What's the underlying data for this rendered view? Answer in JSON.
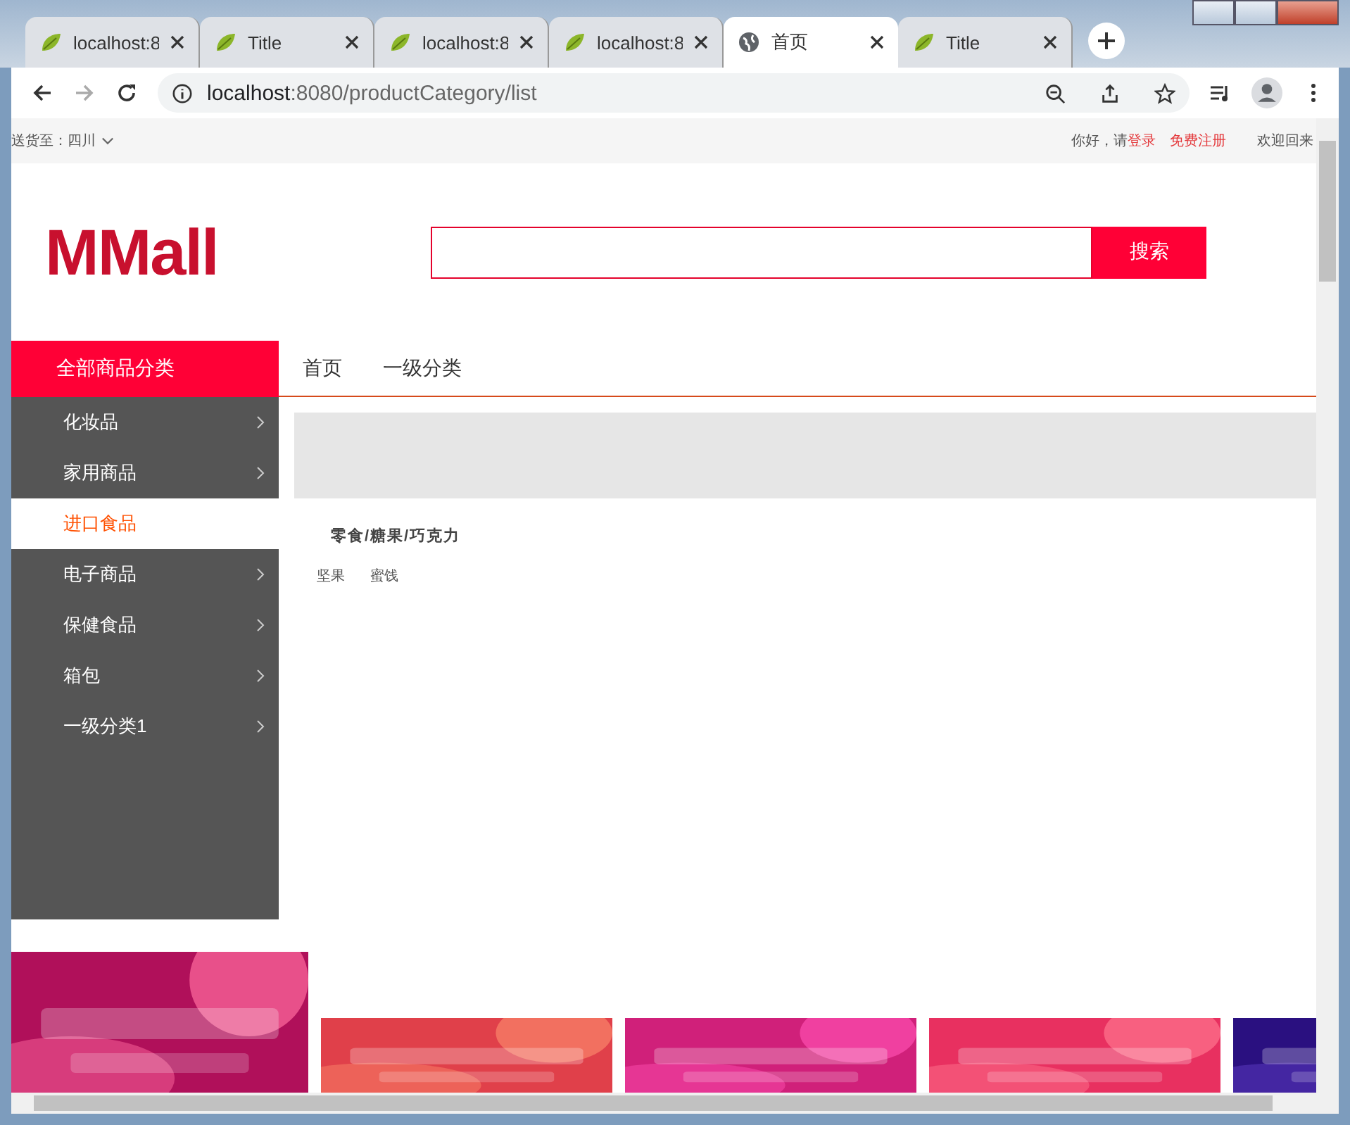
{
  "browser": {
    "tabs": [
      {
        "title": "localhost:8",
        "kind": "leaf",
        "selected": false
      },
      {
        "title": "Title",
        "kind": "leaf",
        "selected": false
      },
      {
        "title": "localhost:8",
        "kind": "leaf",
        "selected": false
      },
      {
        "title": "localhost:8",
        "kind": "leaf",
        "selected": false
      },
      {
        "title": "首页",
        "kind": "globe",
        "selected": true
      },
      {
        "title": "Title",
        "kind": "leaf",
        "selected": false
      }
    ],
    "address": {
      "host": "localhost",
      "rest": ":8080/productCategory/list"
    }
  },
  "topbar": {
    "location_label": "送货至：",
    "location": "四川",
    "greeting": "你好，请",
    "login": "登录",
    "register": "免费注册",
    "welcome": "欢迎回来"
  },
  "header": {
    "logo": "MMall",
    "search_button": "搜索"
  },
  "nav": {
    "all_categories": "全部商品分类",
    "links": [
      "首页",
      "一级分类"
    ]
  },
  "sidebar": {
    "items": [
      {
        "label": "化妆品",
        "selected": false
      },
      {
        "label": "家用商品",
        "selected": false
      },
      {
        "label": "进口食品",
        "selected": true
      },
      {
        "label": "电子商品",
        "selected": false
      },
      {
        "label": "保健食品",
        "selected": false
      },
      {
        "label": "箱包",
        "selected": false
      },
      {
        "label": "一级分类1",
        "selected": false
      }
    ]
  },
  "content": {
    "groups": [
      {
        "title": "零食/糖果/巧克力",
        "items": [
          "坚果",
          "蜜饯"
        ]
      }
    ]
  }
}
